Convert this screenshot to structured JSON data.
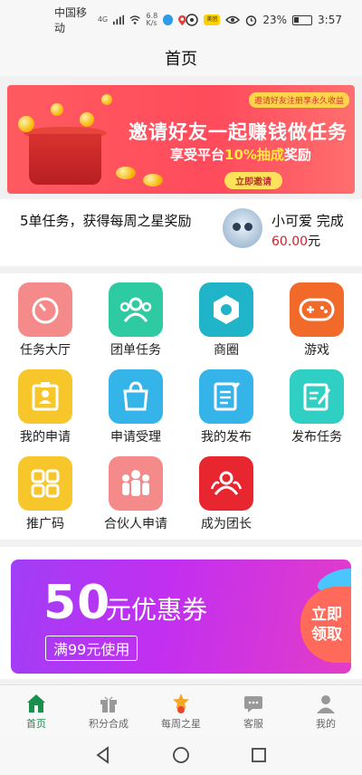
{
  "status_bar": {
    "carrier": "中国移动",
    "network_badge": "4G",
    "speed_top": "6.8",
    "speed_unit": "K/s",
    "app_badge": "美团",
    "battery": "23%",
    "time": "3:57"
  },
  "header": {
    "title": "首页"
  },
  "banner": {
    "tag": "邀请好友注册享永久收益",
    "title": "邀请好友一起赚钱做任务",
    "subtitle_prefix": "享受平台",
    "subtitle_highlight": "10%抽成",
    "subtitle_suffix": "奖励",
    "cta": "立即邀请"
  },
  "news": {
    "text": "5单任务，获得每周之星奖励",
    "user_name": "小可爱  完成",
    "amount": "60.00",
    "amount_unit": "元"
  },
  "grid": {
    "items": [
      {
        "label": "任务大厅",
        "icon": "timer-icon",
        "color": "#f58a8a"
      },
      {
        "label": "团单任务",
        "icon": "group-icon",
        "color": "#2ecba3"
      },
      {
        "label": "商圈",
        "icon": "hexagon-icon",
        "color": "#1fb4c7"
      },
      {
        "label": "游戏",
        "icon": "gamepad-icon",
        "color": "#f26a2a"
      },
      {
        "label": "我的申请",
        "icon": "id-card-icon",
        "color": "#f7c62b"
      },
      {
        "label": "申请受理",
        "icon": "shopping-bag-icon",
        "color": "#35b4ea"
      },
      {
        "label": "我的发布",
        "icon": "document-heart-icon",
        "color": "#35b4ea"
      },
      {
        "label": "发布任务",
        "icon": "edit-note-icon",
        "color": "#2fcfc3"
      },
      {
        "label": "推广码",
        "icon": "qr-code-icon",
        "color": "#f7c62b"
      },
      {
        "label": "合伙人申请",
        "icon": "people-icon",
        "color": "#f58a8a"
      },
      {
        "label": "成为团长",
        "icon": "team-leader-icon",
        "color": "#e8262f"
      }
    ]
  },
  "coupon": {
    "amount": "50",
    "unit": "元优惠券",
    "condition": "满99元使用",
    "claim_line1": "立即",
    "claim_line2": "领取"
  },
  "bottom_nav": {
    "items": [
      {
        "label": "首页",
        "icon": "home-icon"
      },
      {
        "label": "积分合成",
        "icon": "gift-icon"
      },
      {
        "label": "每周之星",
        "icon": "star-medal-icon"
      },
      {
        "label": "客服",
        "icon": "chat-icon"
      },
      {
        "label": "我的",
        "icon": "user-icon"
      }
    ],
    "active_color": "#1b8f4c"
  }
}
